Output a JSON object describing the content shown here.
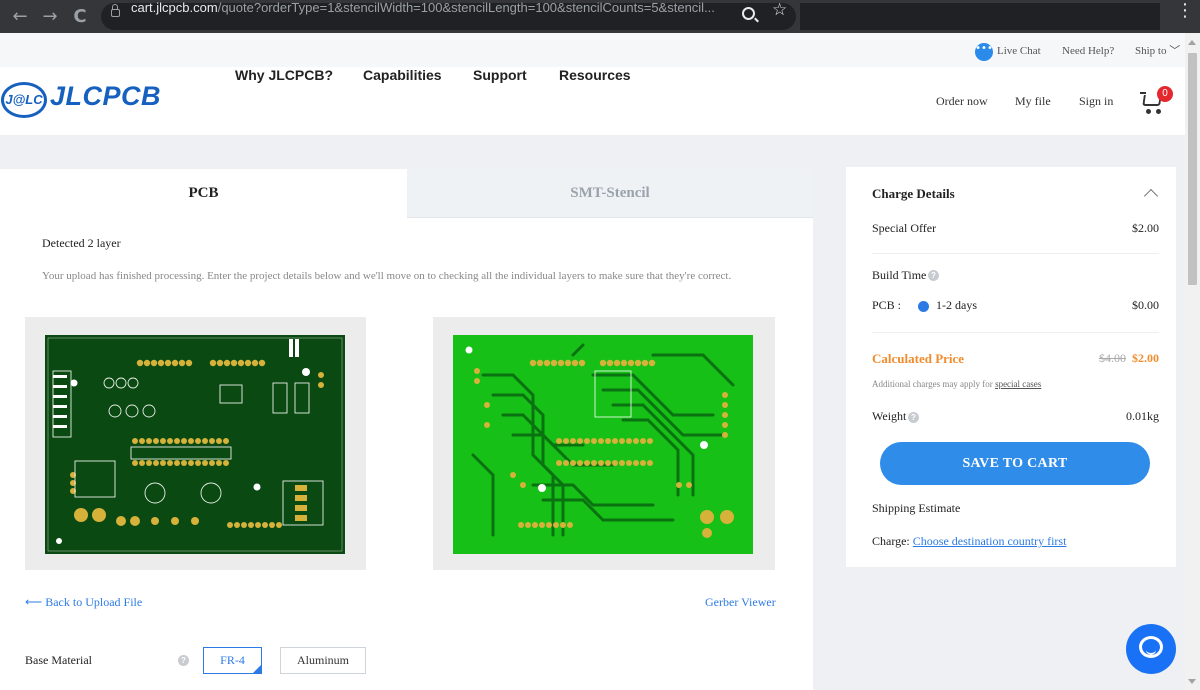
{
  "browser": {
    "url_host": "cart.jlcpcb.com",
    "url_rest": "/quote?orderType=1&stencilWidth=100&stencilLength=100&stencilCounts=5&stencil...",
    "back_glyph": "←",
    "forward_glyph": "→",
    "reload_glyph": "C",
    "star_glyph": "☆",
    "kebab_glyph": "⋮"
  },
  "utilbar": {
    "live_chat": "Live Chat",
    "need_help": "Need Help?",
    "ship_to": "Ship to",
    "ship_chevron": "﹀"
  },
  "header": {
    "logo_mark": "J@LC",
    "logo_text": "JLCPCB",
    "nav": [
      "Why JLCPCB?",
      "Capabilities",
      "Support",
      "Resources"
    ],
    "right_links": [
      "Order now",
      "My file",
      "Sign in"
    ],
    "cart_count": "0"
  },
  "tabs": {
    "pcb": "PCB",
    "stencil": "SMT-Stencil"
  },
  "upload": {
    "detected": "Detected 2 layer",
    "message": "Your upload has finished processing. Enter the project details below and we'll move on to checking all the individual layers to make sure that they're correct."
  },
  "links": {
    "back": "Back to Upload File",
    "back_arrow": "⟵",
    "gerber": "Gerber Viewer"
  },
  "base_material": {
    "label": "Base Material",
    "help": "?",
    "options": [
      "FR-4",
      "Aluminum"
    ],
    "selected": "FR-4"
  },
  "charge": {
    "title": "Charge Details",
    "special_offer": "Special Offer",
    "special_offer_amt": "$2.00",
    "build_time": "Build Time",
    "help": "?",
    "pcb_label": "PCB :",
    "pcb_option": "1-2 days",
    "pcb_amt": "$0.00",
    "calculated_price": "Calculated Price",
    "old_price": "$4.00",
    "new_price": "$2.00",
    "note_prefix": "Additional charges may apply for ",
    "note_link": "special cases",
    "weight": "Weight",
    "weight_value": "0.01kg",
    "save_button": "SAVE TO CART",
    "shipping_estimate": "Shipping Estimate",
    "charge_label": "Charge: ",
    "charge_link": "Choose destination country first"
  },
  "colors": {
    "brand_blue": "#1660c0",
    "accent_blue": "#2c7be5",
    "orange": "#f08c2e",
    "pcb_dark_green": "#0a4a12",
    "pcb_bright_green": "#16c016",
    "pad_gold": "#d6b23a"
  },
  "icons": {
    "chat_icon": "chat-bubble-icon",
    "cart_icon": "shopping-cart-icon",
    "messenger_icon": "messenger-chat-icon"
  }
}
